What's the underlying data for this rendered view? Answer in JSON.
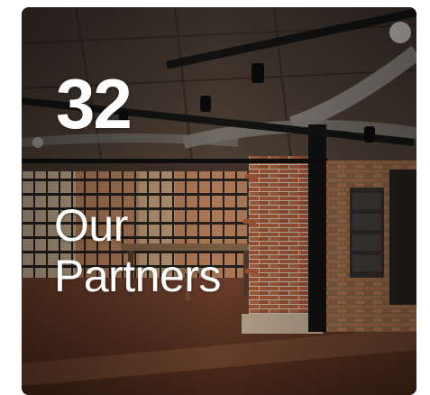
{
  "card": {
    "stat_number": "32",
    "label_line1": "Our",
    "label_line2": "Partners"
  },
  "colors": {
    "text": "#ffffff",
    "ceiling": "#3a2e26",
    "brick": "#a0583a",
    "beam": "#141414",
    "floor": "#6a3a28"
  }
}
